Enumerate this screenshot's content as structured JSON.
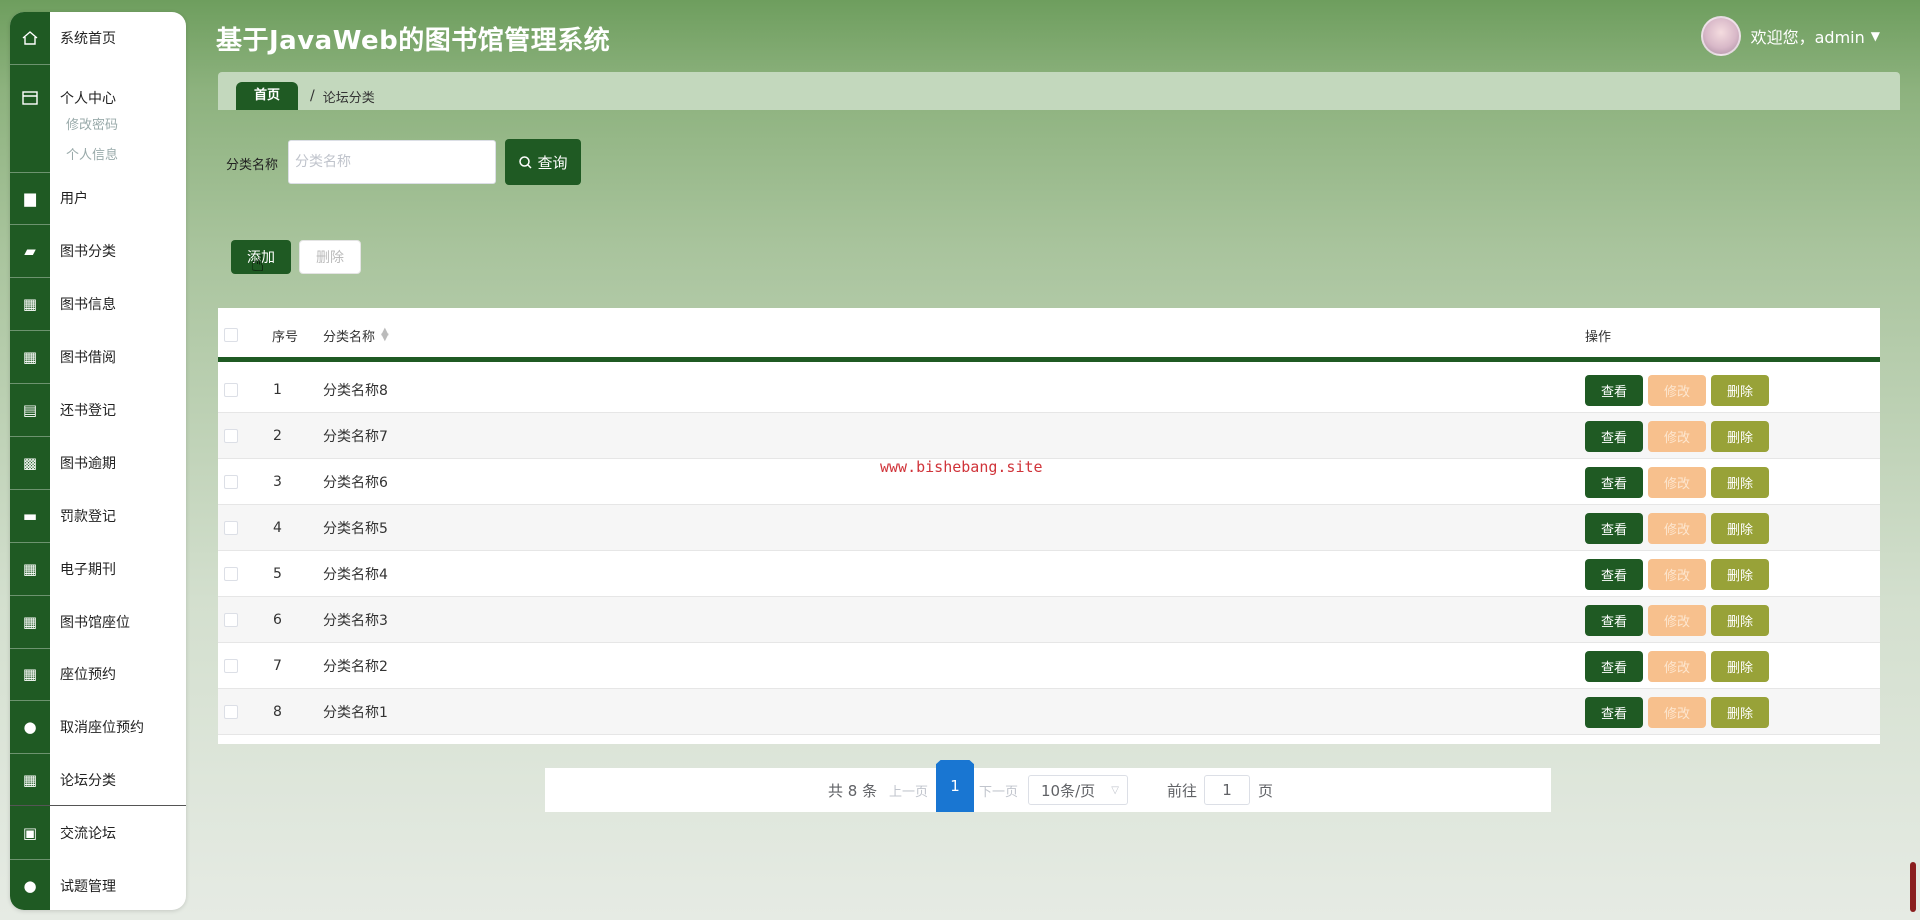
{
  "app": {
    "title": "基于JavaWeb的图书馆管理系统"
  },
  "user": {
    "greeting": "欢迎您，admin"
  },
  "sidebar": {
    "items": [
      {
        "label": "系统首页",
        "icon": "home-icon"
      },
      {
        "label": "个人中心",
        "icon": "profile-icon"
      },
      {
        "label": "用户",
        "icon": "briefcase-icon"
      },
      {
        "label": "图书分类",
        "icon": "book-category-icon"
      },
      {
        "label": "图书信息",
        "icon": "grid-icon"
      },
      {
        "label": "图书借阅",
        "icon": "grid-icon"
      },
      {
        "label": "还书登记",
        "icon": "clipboard-icon"
      },
      {
        "label": "图书逾期",
        "icon": "table-grid-icon"
      },
      {
        "label": "罚款登记",
        "icon": "printer-icon"
      },
      {
        "label": "电子期刊",
        "icon": "grid-icon"
      },
      {
        "label": "图书馆座位",
        "icon": "grid-icon"
      },
      {
        "label": "座位预约",
        "icon": "grid-icon"
      },
      {
        "label": "取消座位预约",
        "icon": "lightbulb-icon"
      },
      {
        "label": "论坛分类",
        "icon": "grid-icon"
      },
      {
        "label": "交流论坛",
        "icon": "clipboard-check-icon"
      },
      {
        "label": "试题管理",
        "icon": "user-icon"
      }
    ],
    "sub_items": [
      "修改密码",
      "个人信息"
    ]
  },
  "breadcrumb": {
    "home": "首页",
    "separator": "/",
    "current": "论坛分类"
  },
  "search": {
    "label": "分类名称",
    "placeholder": "分类名称",
    "button": "查询"
  },
  "actions": {
    "add": "添加",
    "delete": "删除"
  },
  "table": {
    "headers": {
      "index": "序号",
      "name": "分类名称",
      "ops": "操作"
    },
    "rows": [
      {
        "index": "1",
        "name": "分类名称8"
      },
      {
        "index": "2",
        "name": "分类名称7"
      },
      {
        "index": "3",
        "name": "分类名称6"
      },
      {
        "index": "4",
        "name": "分类名称5"
      },
      {
        "index": "5",
        "name": "分类名称4"
      },
      {
        "index": "6",
        "name": "分类名称3"
      },
      {
        "index": "7",
        "name": "分类名称2"
      },
      {
        "index": "8",
        "name": "分类名称1"
      }
    ],
    "row_buttons": {
      "view": "查看",
      "edit": "修改",
      "delete": "删除"
    }
  },
  "watermark": "www.bishebang.site",
  "pagination": {
    "total": "共 8 条",
    "prev": "上一页",
    "current": "1",
    "next": "下一页",
    "page_size": "10条/页",
    "goto": "前往",
    "goto_value": "1",
    "page_unit": "页"
  },
  "colors": {
    "primary": "#1f5a23",
    "edit": "#f7c08d",
    "delete": "#98a238",
    "page_active": "#1976d2"
  }
}
